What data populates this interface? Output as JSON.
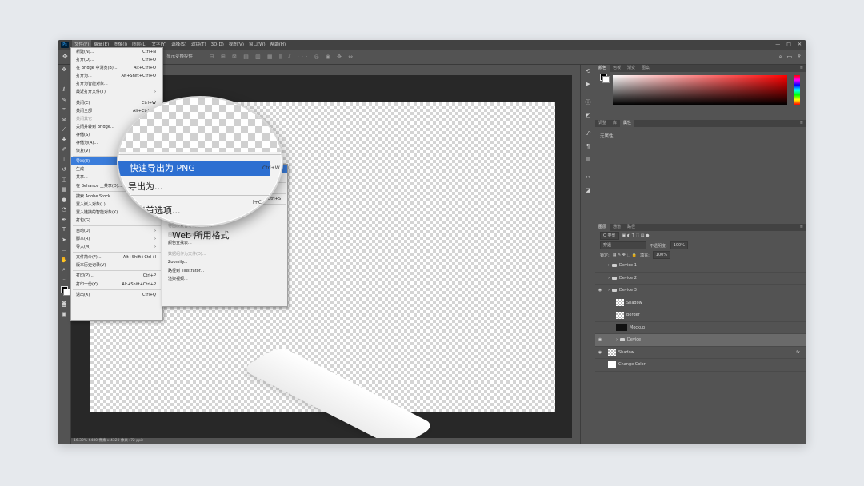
{
  "app": {
    "logo": "Ps",
    "menu": [
      "文件(F)",
      "编辑(E)",
      "图像(I)",
      "图层(L)",
      "文字(Y)",
      "选择(S)",
      "滤镜(T)",
      "3D(D)",
      "视图(V)",
      "窗口(W)",
      "帮助(H)"
    ],
    "window_controls": [
      "—",
      "□",
      "✕"
    ]
  },
  "options_bar": {
    "transform_label": "显示变换控件",
    "right_icons": [
      "search-icon",
      "workspace-icon",
      "share-icon"
    ]
  },
  "tools": [
    "move-icon",
    "marquee-icon",
    "lasso-icon",
    "quick-select-icon",
    "crop-icon",
    "frame-icon",
    "eyedropper-icon",
    "healing-icon",
    "brush-icon",
    "stamp-icon",
    "history-brush-icon",
    "eraser-icon",
    "gradient-icon",
    "blur-icon",
    "dodge-icon",
    "pen-icon",
    "type-icon",
    "path-select-icon",
    "shape-icon",
    "hand-icon",
    "zoom-icon",
    "more-icon"
  ],
  "file_menu": [
    {
      "label": "新建(N)...",
      "shortcut": "Ctrl+N"
    },
    {
      "label": "打开(O)...",
      "shortcut": "Ctrl+O"
    },
    {
      "label": "在 Bridge 中浏览(B)...",
      "shortcut": "Alt+Ctrl+O"
    },
    {
      "label": "打开为...",
      "shortcut": "Alt+Shift+Ctrl+O"
    },
    {
      "label": "打开为智能对象...",
      "shortcut": ""
    },
    {
      "label": "最近打开文件(T)",
      "shortcut": "",
      "submenu": true
    },
    {
      "sep": true
    },
    {
      "label": "关闭(C)",
      "shortcut": "Ctrl+W"
    },
    {
      "label": "关闭全部",
      "shortcut": "Alt+Ctrl+W"
    },
    {
      "label": "关闭其它",
      "shortcut": "Alt+C",
      "disabled": true
    },
    {
      "label": "关闭并转到 Bridge...",
      "shortcut": "Shift+C"
    },
    {
      "label": "存储(S)",
      "shortcut": ""
    },
    {
      "label": "存储为(A)...",
      "shortcut": "S"
    },
    {
      "label": "恢复(V)",
      "shortcut": ""
    },
    {
      "sep": true
    },
    {
      "label": "导出(E)",
      "shortcut": "",
      "highlight": true
    },
    {
      "label": "生成",
      "shortcut": ""
    },
    {
      "label": "共享...",
      "shortcut": ""
    },
    {
      "label": "在 Behance 上共享(D)...",
      "shortcut": ""
    },
    {
      "sep": true
    },
    {
      "label": "搜索 Adobe Stock...",
      "shortcut": ""
    },
    {
      "label": "置入嵌入对象(L)...",
      "shortcut": ""
    },
    {
      "label": "置入链接的智能对象(K)...",
      "shortcut": ""
    },
    {
      "label": "打包(G)...",
      "shortcut": ""
    },
    {
      "sep": true
    },
    {
      "label": "自动(U)",
      "shortcut": "",
      "submenu": true
    },
    {
      "label": "脚本(R)",
      "shortcut": "",
      "submenu": true
    },
    {
      "label": "导入(M)",
      "shortcut": "",
      "submenu": true
    },
    {
      "sep": true
    },
    {
      "label": "文件简介(F)...",
      "shortcut": "Alt+Shift+Ctrl+I"
    },
    {
      "label": "版本历史记录(V)",
      "shortcut": ""
    },
    {
      "sep": true
    },
    {
      "label": "打印(P)...",
      "shortcut": "Ctrl+P"
    },
    {
      "label": "打印一份(Y)",
      "shortcut": "Alt+Shift+Ctrl+P"
    },
    {
      "sep": true
    },
    {
      "label": "退出(X)",
      "shortcut": "Ctrl+Q"
    }
  ],
  "export_submenu": [
    {
      "label": "快速导出为 PNG",
      "shortcut": "",
      "highlight": true
    },
    {
      "label": "导出为...",
      "shortcut": "Alt+Shift+Ctrl+W"
    },
    {
      "sep": true
    },
    {
      "label": "导出首选项...",
      "shortcut": ""
    },
    {
      "sep": true
    },
    {
      "label": "存储为 Web 所用格式 (旧版)...",
      "shortcut": "Alt+Shift+Ctrl+S"
    },
    {
      "sep": true
    },
    {
      "label": "画板至文件...",
      "shortcut": ""
    },
    {
      "label": "将画板导出到 PDF...",
      "shortcut": "",
      "disabled": true
    },
    {
      "label": "将图层复合导出到 PDF...",
      "shortcut": "",
      "disabled": true
    },
    {
      "label": "图层复合导出到文件...",
      "shortcut": "",
      "disabled": true
    },
    {
      "label": "颜色查找表...",
      "shortcut": ""
    },
    {
      "sep": true
    },
    {
      "label": "数据组作为文件(D)...",
      "shortcut": "",
      "disabled": true
    },
    {
      "label": "Zoomify...",
      "shortcut": ""
    },
    {
      "label": "路径到 Illustrator...",
      "shortcut": ""
    },
    {
      "label": "渲染视频...",
      "shortcut": ""
    }
  ],
  "magnifier": {
    "item1": "快速导出为 PNG",
    "item1_shortcut": "Ctrl+W",
    "item2": "导出为...",
    "item3": "导出首选项...",
    "item3_shortcut": "l+Ctrl+S",
    "item4": "Web 所用格式"
  },
  "status_bar": "16.32%    6480 像素 x 4320 像素 (72 ppi)",
  "color_panel": {
    "tabs": [
      "颜色",
      "色板",
      "渐变",
      "图案"
    ]
  },
  "props_panel": {
    "tabs": [
      "调整",
      "库",
      "属性"
    ],
    "content": "无属性"
  },
  "layers_panel": {
    "tabs": [
      "图层",
      "通道",
      "路径"
    ],
    "filter_label": "Q 类型",
    "blend_mode": "穿透",
    "opacity_label": "不透明度:",
    "opacity_value": "100%",
    "lock_label": "锁定:",
    "fill_label": "填充:",
    "fill_value": "100%",
    "fx_label": "fx",
    "layers": [
      {
        "name": "Device 1",
        "type": "folder",
        "visible": false,
        "selected": false,
        "indent": 0
      },
      {
        "name": "Device 2",
        "type": "folder",
        "visible": false,
        "selected": false,
        "indent": 0
      },
      {
        "name": "Device 3",
        "type": "folder",
        "visible": true,
        "selected": false,
        "indent": 0
      },
      {
        "name": "Shadow",
        "type": "smart",
        "visible": false,
        "selected": false,
        "indent": 1
      },
      {
        "name": "Border",
        "type": "smart",
        "visible": false,
        "selected": false,
        "indent": 1
      },
      {
        "name": "Mockup",
        "type": "mask",
        "visible": false,
        "selected": false,
        "indent": 1
      },
      {
        "name": "Device",
        "type": "folder",
        "visible": true,
        "selected": true,
        "indent": 1
      },
      {
        "name": "Shadow",
        "type": "smart",
        "visible": true,
        "selected": false,
        "indent": 0,
        "fx": true
      },
      {
        "name": "Change Color",
        "type": "fill",
        "visible": false,
        "selected": false,
        "indent": 0
      }
    ],
    "bottom_icons": [
      "link-icon",
      "fx-icon",
      "mask-icon",
      "adjustment-icon",
      "group-icon",
      "new-layer-icon",
      "delete-icon"
    ]
  }
}
